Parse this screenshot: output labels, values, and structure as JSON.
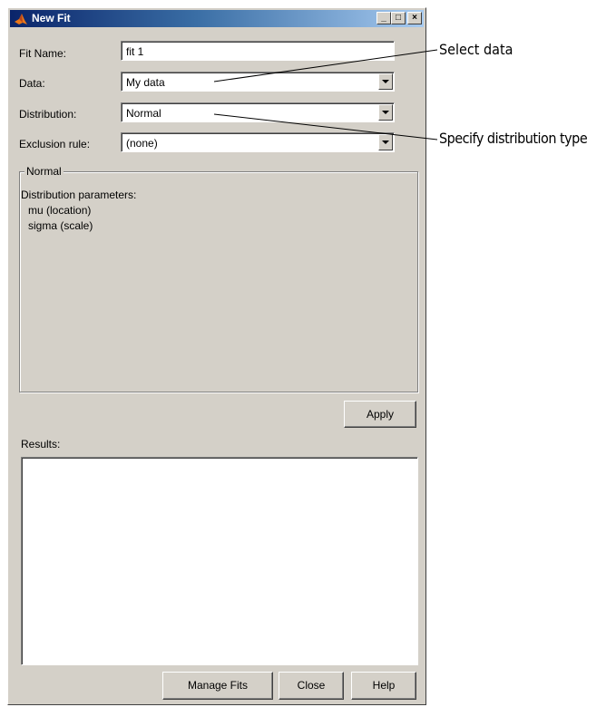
{
  "window": {
    "title": "New Fit",
    "icon": "matlab-icon"
  },
  "titlebar_buttons": {
    "minimize": "_",
    "maximize": "□",
    "close": "×"
  },
  "form": {
    "fit_name_label": "Fit Name:",
    "fit_name_value": "fit 1",
    "data_label": "Data:",
    "data_value": "My data",
    "distribution_label": "Distribution:",
    "distribution_value": "Normal",
    "exclusion_label": "Exclusion rule:",
    "exclusion_value": "(none)"
  },
  "group": {
    "title": "Normal",
    "heading": "Distribution parameters:",
    "params": [
      "mu (location)",
      "sigma (scale)"
    ]
  },
  "buttons": {
    "apply": "Apply",
    "manage_fits": "Manage Fits",
    "close": "Close",
    "help": "Help"
  },
  "results": {
    "label": "Results:"
  },
  "callouts": {
    "select_data": "Select data",
    "specify_distribution": "Specify distribution type"
  }
}
